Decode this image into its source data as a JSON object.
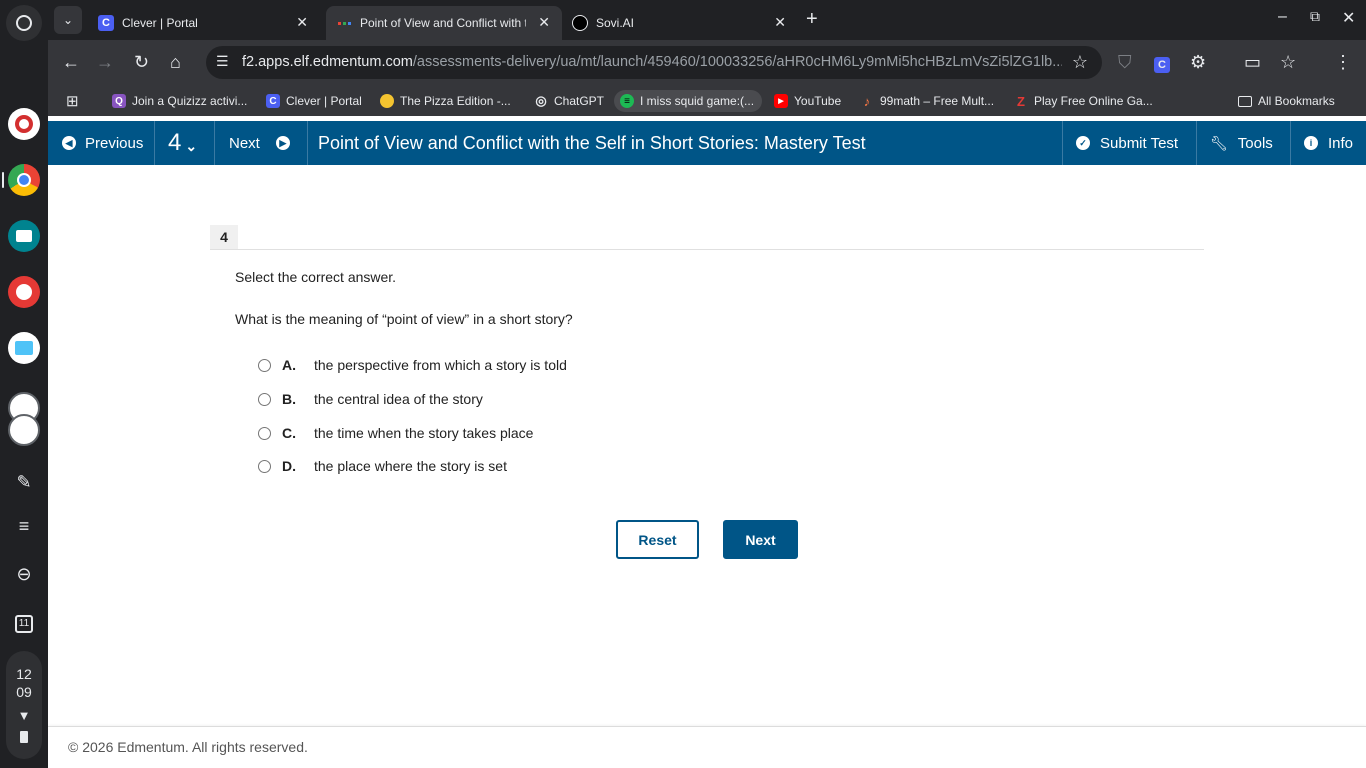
{
  "shelf": {
    "clock_hour": "12",
    "clock_minute": "09",
    "calendar_day": "11"
  },
  "tabs": [
    {
      "title": "Clever | Portal",
      "favicon": "C"
    },
    {
      "title": "Point of View and Conflict with the Self in Short Stories: Mastery Test",
      "favicon": "edmentum"
    },
    {
      "title": "Sovi.AI",
      "favicon": "sovi"
    }
  ],
  "omnibox": {
    "host": "f2.apps.elf.edmentum.com",
    "path": "/assessments-delivery/ua/mt/launch/459460/100033256/aHR0cHM6Ly9mMi5hcHBzLmVsZi5lZG1lb..."
  },
  "bookmarks": [
    {
      "label": "Join a Quizizz activi...",
      "icon": "Q",
      "color": "#8854c0"
    },
    {
      "label": "Clever | Portal",
      "icon": "C",
      "color": "#4b5ff2"
    },
    {
      "label": "The Pizza Edition -...",
      "icon": "●",
      "color": "#f4c430"
    },
    {
      "label": "ChatGPT",
      "icon": "◎",
      "color": "#35363a"
    },
    {
      "label": "I miss squid game:(...",
      "icon": "≡",
      "color": "#1db954"
    },
    {
      "label": "YouTube",
      "icon": "▶",
      "color": "#ff0000"
    },
    {
      "label": "99math – Free Mult...",
      "icon": "♪",
      "color": "#ff7a45"
    },
    {
      "label": "Play Free Online Ga...",
      "icon": "Z",
      "color": "#e53935"
    }
  ],
  "all_bookmarks": "All Bookmarks",
  "appbar": {
    "previous": "Previous",
    "question_number": "4",
    "next": "Next",
    "title": "Point of View and Conflict with the Self in Short Stories: Mastery Test",
    "submit": "Submit Test",
    "tools": "Tools",
    "info": "Info"
  },
  "question": {
    "number": "4",
    "instruction": "Select the correct answer.",
    "text": "What is the meaning of “point of view” in a short story?",
    "options": [
      {
        "letter": "A.",
        "text": "the perspective from which a story is told",
        "selected": false
      },
      {
        "letter": "B.",
        "text": "the central idea of the story",
        "selected": false
      },
      {
        "letter": "C.",
        "text": "the time when the story takes place",
        "selected": false
      },
      {
        "letter": "D.",
        "text": "the place where the story is set",
        "selected": false
      }
    ],
    "reset_label": "Reset",
    "next_label": "Next"
  },
  "footer": "© 2026 Edmentum. All rights reserved.",
  "colors": {
    "brand": "#005587",
    "chrome_dark": "#202124",
    "chrome_toolbar": "#35363a"
  }
}
